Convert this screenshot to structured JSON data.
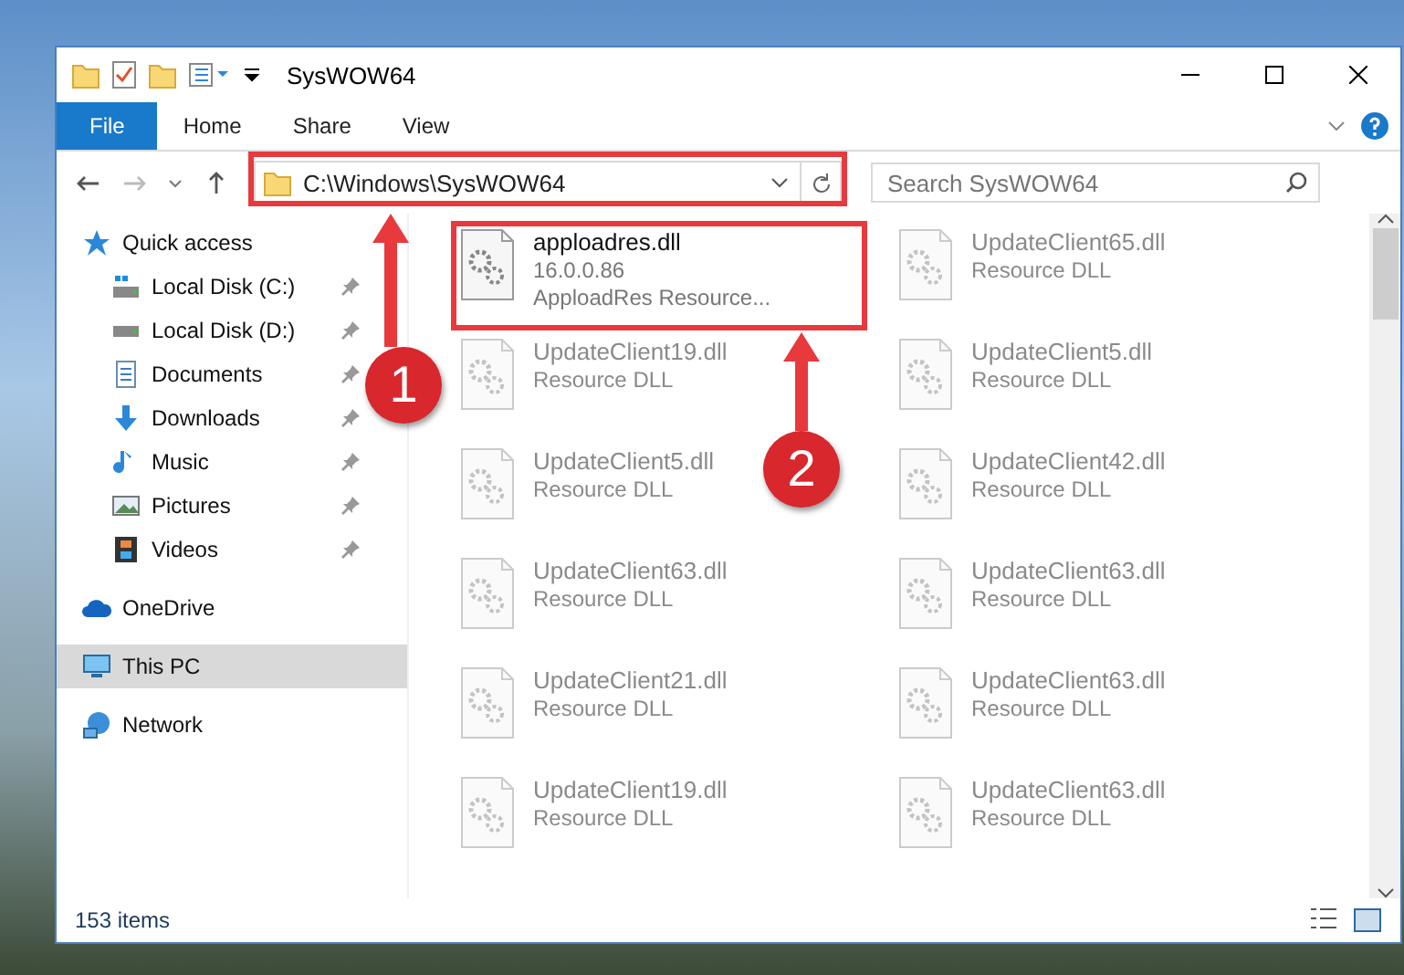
{
  "window": {
    "title": "SysWOW64"
  },
  "ribbon_tabs": [
    {
      "label": "File",
      "selected": true
    },
    {
      "label": "Home",
      "selected": false
    },
    {
      "label": "Share",
      "selected": false
    },
    {
      "label": "View",
      "selected": false
    }
  ],
  "address": {
    "value": "C:\\Windows\\SysWOW64"
  },
  "search": {
    "placeholder": "Search SysWOW64"
  },
  "sidebar": {
    "items": [
      {
        "label": "Quick access",
        "kind": "star",
        "selected": false,
        "pinned": false,
        "children": [
          {
            "label": "Local Disk (C:)",
            "kind": "diskc",
            "selected": false,
            "pinned": true
          },
          {
            "label": "Local Disk (D:)",
            "kind": "disk",
            "selected": false,
            "pinned": true
          },
          {
            "label": "Documents",
            "kind": "doc",
            "selected": false,
            "pinned": true
          },
          {
            "label": "Downloads",
            "kind": "down",
            "selected": false,
            "pinned": true
          },
          {
            "label": "Music",
            "kind": "music",
            "selected": false,
            "pinned": true
          },
          {
            "label": "Pictures",
            "kind": "pic",
            "selected": false,
            "pinned": true
          },
          {
            "label": "Videos",
            "kind": "video",
            "selected": false,
            "pinned": true
          }
        ]
      },
      {
        "label": "OneDrive",
        "kind": "cloud",
        "selected": false,
        "pinned": false
      },
      {
        "label": "This PC",
        "kind": "pc",
        "selected": true,
        "pinned": false
      },
      {
        "label": "Network",
        "kind": "net",
        "selected": false,
        "pinned": false
      }
    ]
  },
  "files": [
    {
      "name": "apploadres.dll",
      "lines": [
        "16.0.0.86",
        "ApploadRes Resource..."
      ],
      "blurred": false
    },
    {
      "name": "UpdateClient65.dll",
      "lines": [
        "Resource DLL"
      ],
      "blurred": true
    },
    {
      "name": "UpdateClient19.dll",
      "lines": [
        "Resource DLL"
      ],
      "blurred": true
    },
    {
      "name": "UpdateClient5.dll",
      "lines": [
        "Resource DLL"
      ],
      "blurred": true
    },
    {
      "name": "UpdateClient5.dll",
      "lines": [
        "Resource DLL"
      ],
      "blurred": true
    },
    {
      "name": "UpdateClient42.dll",
      "lines": [
        "Resource DLL"
      ],
      "blurred": true
    },
    {
      "name": "UpdateClient63.dll",
      "lines": [
        "Resource DLL"
      ],
      "blurred": true
    },
    {
      "name": "UpdateClient63.dll",
      "lines": [
        "Resource DLL"
      ],
      "blurred": true
    },
    {
      "name": "UpdateClient21.dll",
      "lines": [
        "Resource DLL"
      ],
      "blurred": true
    },
    {
      "name": "UpdateClient63.dll",
      "lines": [
        "Resource DLL"
      ],
      "blurred": true
    },
    {
      "name": "UpdateClient19.dll",
      "lines": [
        "Resource DLL"
      ],
      "blurred": true
    },
    {
      "name": "UpdateClient63.dll",
      "lines": [
        "Resource DLL"
      ],
      "blurred": true
    }
  ],
  "status_bar": {
    "count": "153 items"
  },
  "annotations": [
    {
      "number": "1"
    },
    {
      "number": "2"
    }
  ]
}
